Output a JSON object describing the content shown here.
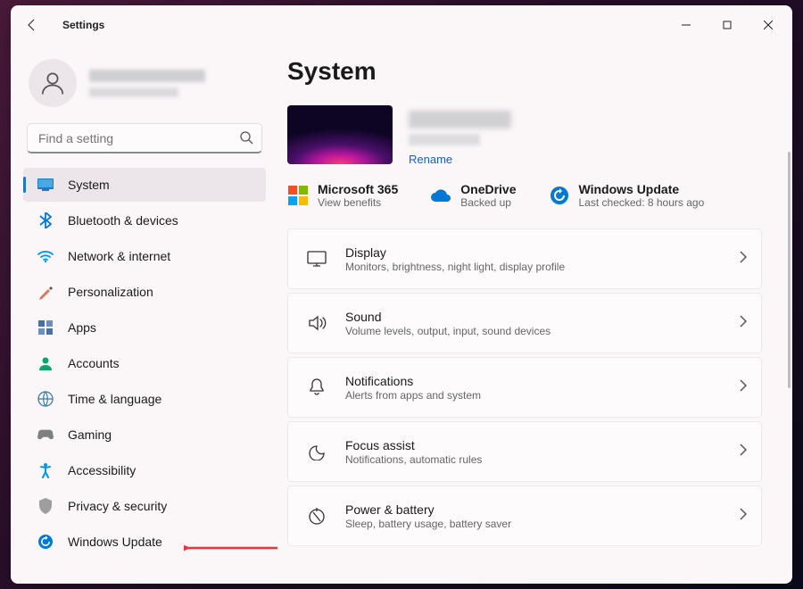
{
  "window": {
    "title": "Settings"
  },
  "search": {
    "placeholder": "Find a setting"
  },
  "sidebar": {
    "items": [
      {
        "label": "System",
        "icon": "🖥️",
        "iconClass": "ic-system",
        "active": true
      },
      {
        "label": "Bluetooth & devices",
        "icon": "ᛒ",
        "iconClass": "ic-bt"
      },
      {
        "label": "Network & internet",
        "icon": "📶",
        "iconClass": "ic-net"
      },
      {
        "label": "Personalization",
        "icon": "🖌️",
        "iconClass": "ic-pers"
      },
      {
        "label": "Apps",
        "icon": "▦",
        "iconClass": ""
      },
      {
        "label": "Accounts",
        "icon": "👤",
        "iconClass": "ic-acct"
      },
      {
        "label": "Time & language",
        "icon": "🌐",
        "iconClass": "ic-time"
      },
      {
        "label": "Gaming",
        "icon": "🎮",
        "iconClass": "ic-game"
      },
      {
        "label": "Accessibility",
        "icon": "✲",
        "iconClass": "ic-acc"
      },
      {
        "label": "Privacy & security",
        "icon": "🛡️",
        "iconClass": "ic-priv"
      },
      {
        "label": "Windows Update",
        "icon": "🔄",
        "iconClass": "ic-wu"
      }
    ]
  },
  "page": {
    "title": "System",
    "rename_label": "Rename",
    "status": [
      {
        "title": "Microsoft 365",
        "sub": "View benefits"
      },
      {
        "title": "OneDrive",
        "sub": "Backed up"
      },
      {
        "title": "Windows Update",
        "sub": "Last checked: 8 hours ago"
      }
    ],
    "cards": [
      {
        "title": "Display",
        "sub": "Monitors, brightness, night light, display profile"
      },
      {
        "title": "Sound",
        "sub": "Volume levels, output, input, sound devices"
      },
      {
        "title": "Notifications",
        "sub": "Alerts from apps and system"
      },
      {
        "title": "Focus assist",
        "sub": "Notifications, automatic rules"
      },
      {
        "title": "Power & battery",
        "sub": "Sleep, battery usage, battery saver"
      }
    ]
  },
  "annotation": {
    "arrow_target": "Windows Update"
  }
}
